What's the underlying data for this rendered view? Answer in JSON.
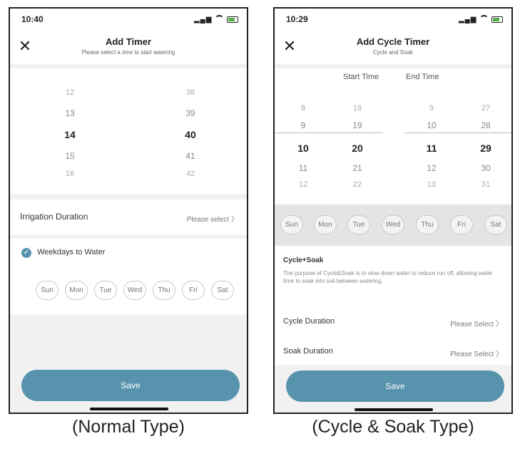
{
  "normal": {
    "status_time": "10:40",
    "header": {
      "title": "Add Timer",
      "subtitle": "Please select a time to start watering"
    },
    "wheel": {
      "hours": [
        "12",
        "13",
        "14",
        "15",
        "16"
      ],
      "minutes": [
        "38",
        "39",
        "40",
        "41",
        "42"
      ],
      "hours_edge": [
        "",
        ""
      ],
      "minutes_edge": [
        "",
        ""
      ]
    },
    "duration_row": {
      "label": "Irrigation Duration",
      "value": "Please select"
    },
    "weekdays": {
      "label": "Weekdays to Water",
      "days": [
        "Sun",
        "Mon",
        "Tue",
        "Wed",
        "Thu",
        "Fri",
        "Sat"
      ]
    },
    "save_label": "Save"
  },
  "cycle": {
    "status_time": "10:29",
    "header": {
      "title": "Add Cycle Timer",
      "subtitle": "Cycle and Soak"
    },
    "columns": {
      "start_label": "Start Time",
      "end_label": "End Time"
    },
    "start_hours": [
      "8",
      "9",
      "10",
      "11",
      "12"
    ],
    "start_minutes": [
      "18",
      "19",
      "20",
      "21",
      "22"
    ],
    "end_hours": [
      "9",
      "10",
      "11",
      "12",
      "13"
    ],
    "end_minutes": [
      "27",
      "28",
      "29",
      "30",
      "31"
    ],
    "days": [
      "Sun",
      "Mon",
      "Tue",
      "Wed",
      "Thu",
      "Fri",
      "Sat"
    ],
    "cycle_soak": {
      "title": "Cycle+Soak",
      "description": "The purpose of Cycle&Soak is to slow down water to reduce run off, allowing water time to soak into soil between watering."
    },
    "cycle_duration": {
      "label": "Cycle Duration",
      "value": "Please Select"
    },
    "soak_duration": {
      "label": "Soak Duration",
      "value": "Please Select"
    },
    "save_label": "Save"
  },
  "captions": {
    "left": "(Normal Type)",
    "right": "(Cycle & Soak Type)"
  },
  "colors": {
    "accent": "#5793ad",
    "background": "#f1f1f1"
  }
}
